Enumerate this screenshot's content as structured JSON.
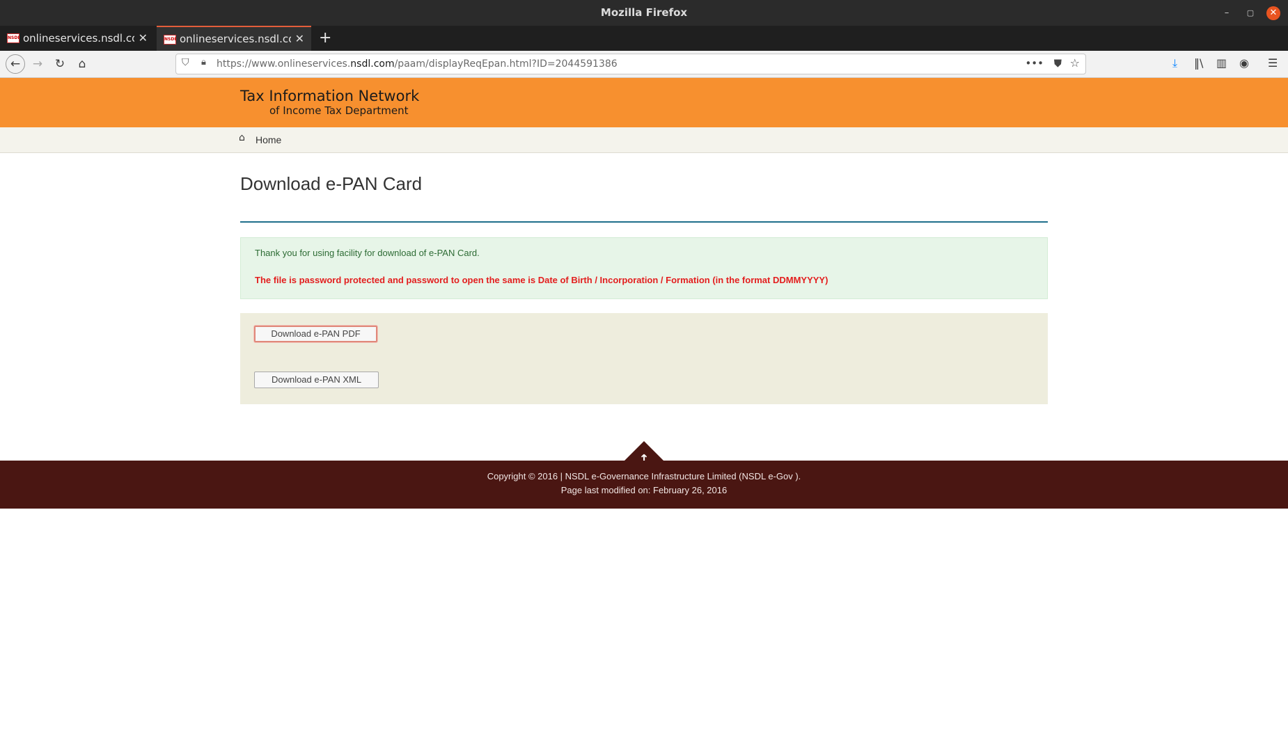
{
  "browser": {
    "window_title": "Mozilla Firefox",
    "tabs": [
      {
        "label": "onlineservices.nsdl.com/",
        "favicon": "NSDL",
        "active": false
      },
      {
        "label": "onlineservices.nsdl.com/",
        "favicon": "NSDL",
        "active": true
      }
    ],
    "url_prefix": "https://www.onlineservices.",
    "url_domain": "nsdl.com",
    "url_suffix": "/paam/displayReqEpan.html?ID=2044591386"
  },
  "site": {
    "brand_line1": "Tax Information Network",
    "brand_line2": "of Income Tax Department",
    "nav_home": "Home"
  },
  "main": {
    "title": "Download e-PAN Card",
    "thanks_message": "Thank you for using facility for download of e-PAN Card.",
    "password_notice": "The file is password protected and password to open the same is Date of Birth / Incorporation / Formation (in the format DDMMYYYY)",
    "download_pdf_label": "Download e-PAN PDF",
    "download_xml_label": "Download e-PAN XML"
  },
  "footer": {
    "copyright": "Copyright © 2016 | NSDL e-Governance Infrastructure Limited (NSDL e-Gov ).",
    "last_modified": "Page last modified on: February 26, 2016"
  },
  "colors": {
    "header_orange": "#f7902f",
    "footer_maroon": "#4a1612",
    "notice_red": "#e31e1e",
    "notice_green_bg": "#e7f5e8"
  }
}
